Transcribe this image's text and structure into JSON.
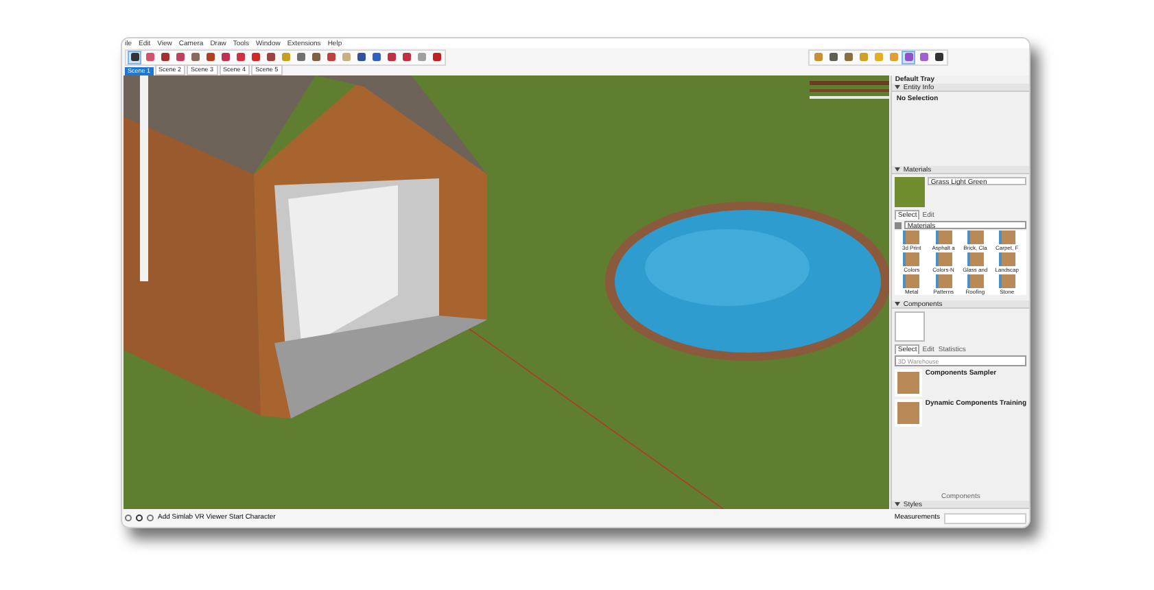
{
  "menu": [
    "ile",
    "Edit",
    "View",
    "Camera",
    "Draw",
    "Tools",
    "Window",
    "Extensions",
    "Help"
  ],
  "toolbars": [
    {
      "tools": [
        {
          "selected": true
        },
        {
          "selected": false
        },
        {
          "selected": false
        },
        {
          "selected": false
        },
        {
          "selected": false
        },
        {
          "selected": false
        },
        {
          "selected": false
        },
        {
          "selected": false
        },
        {
          "selected": false
        },
        {
          "selected": false
        },
        {
          "selected": false
        },
        {
          "selected": false
        },
        {
          "selected": false
        },
        {
          "selected": false
        },
        {
          "selected": false
        },
        {
          "selected": false
        },
        {
          "selected": false
        },
        {
          "selected": false
        },
        {
          "selected": false
        },
        {
          "selected": false
        },
        {
          "selected": false
        }
      ]
    },
    {
      "tools": [
        {
          "selected": false
        },
        {
          "selected": false
        },
        {
          "selected": false
        },
        {
          "selected": false
        },
        {
          "selected": false
        },
        {
          "selected": false
        },
        {
          "selected": true
        },
        {
          "selected": false
        },
        {
          "selected": false
        }
      ]
    }
  ],
  "scenes": [
    {
      "label": "Scene 1",
      "selected": true
    },
    {
      "label": "Scene 2",
      "selected": false
    },
    {
      "label": "Scene 3",
      "selected": false
    },
    {
      "label": "Scene 4",
      "selected": false
    },
    {
      "label": "Scene 5",
      "selected": false
    }
  ],
  "tray": {
    "title": "Default Tray",
    "entity_info": {
      "title": "Entity Info",
      "text": "No Selection"
    },
    "materials": {
      "title": "Materials",
      "name": "Grass Light Green",
      "tabs": [
        {
          "label": "Select",
          "selected": true
        },
        {
          "label": "Edit",
          "selected": false
        }
      ],
      "library": "Materials",
      "items": [
        "3d Print",
        "Asphalt a",
        "Brick, Cla",
        "Carpet, F",
        "Colors",
        "Colors-N",
        "Glass and",
        "Landscap",
        "Metal",
        "Patterns",
        "Roofing",
        "Stone"
      ]
    },
    "components": {
      "title": "Components",
      "tabs": [
        {
          "label": "Select",
          "selected": true
        },
        {
          "label": "Edit",
          "selected": false
        },
        {
          "label": "Statistics",
          "selected": false
        }
      ],
      "search_placeholder": "3D Warehouse",
      "items": [
        "Components Sampler",
        "Dynamic Components Training"
      ],
      "footer": "Components"
    },
    "styles": {
      "title": "Styles"
    }
  },
  "status_bar": {
    "message": "Add Simlab VR Viewer Start Character",
    "measurements_label": "Measurements"
  }
}
